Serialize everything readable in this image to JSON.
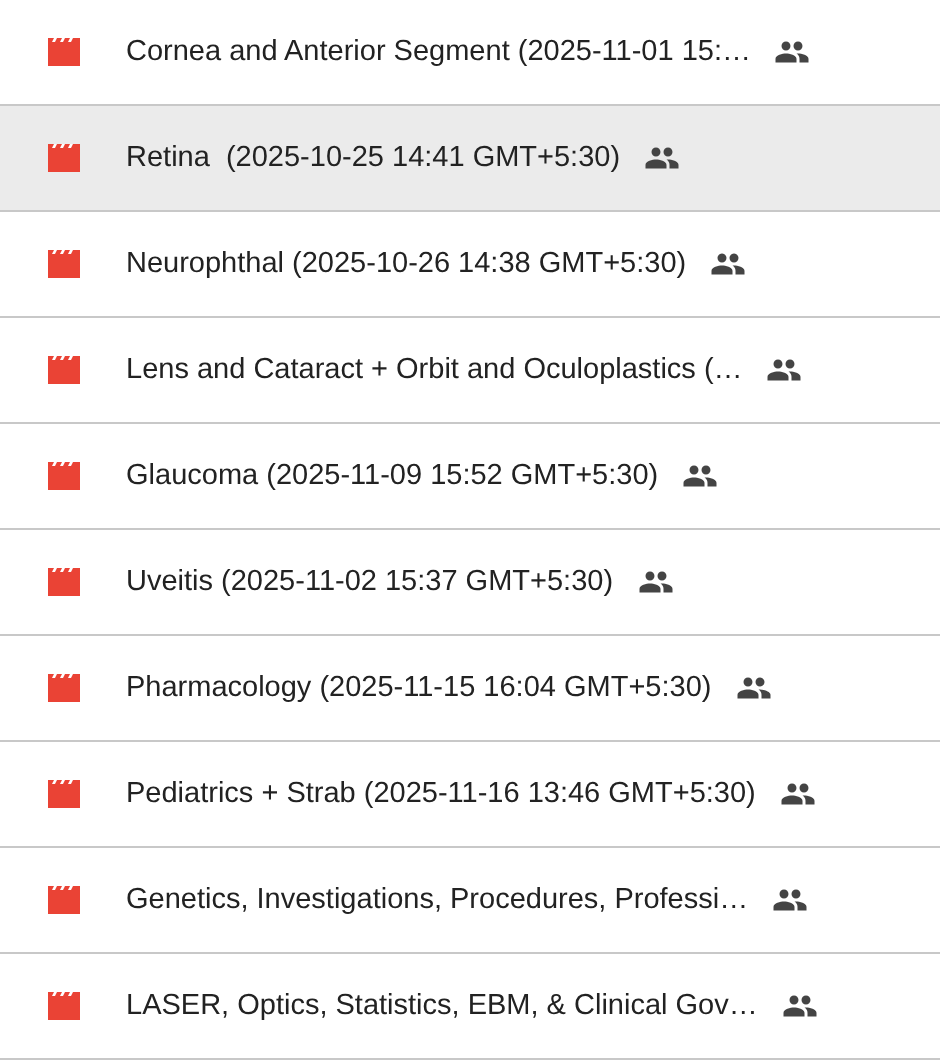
{
  "items": [
    {
      "title": "Cornea and Anterior Segment (2025-11-01 15:…",
      "shared": true,
      "selected": false
    },
    {
      "title": "Retina  (2025-10-25 14:41 GMT+5:30)",
      "shared": true,
      "selected": true
    },
    {
      "title": "Neurophthal (2025-10-26 14:38 GMT+5:30)",
      "shared": true,
      "selected": false
    },
    {
      "title": "Lens and Cataract + Orbit and Oculoplastics (…",
      "shared": true,
      "selected": false
    },
    {
      "title": "Glaucoma (2025-11-09 15:52 GMT+5:30)",
      "shared": true,
      "selected": false
    },
    {
      "title": "Uveitis (2025-11-02 15:37 GMT+5:30)",
      "shared": true,
      "selected": false
    },
    {
      "title": "Pharmacology (2025-11-15 16:04 GMT+5:30)",
      "shared": true,
      "selected": false
    },
    {
      "title": "Pediatrics + Strab (2025-11-16 13:46 GMT+5:30)",
      "shared": true,
      "selected": false
    },
    {
      "title": "Genetics, Investigations, Procedures, Professi…",
      "shared": true,
      "selected": false
    },
    {
      "title": "LASER, Optics, Statistics, EBM, & Clinical Gov…",
      "shared": true,
      "selected": false
    }
  ]
}
